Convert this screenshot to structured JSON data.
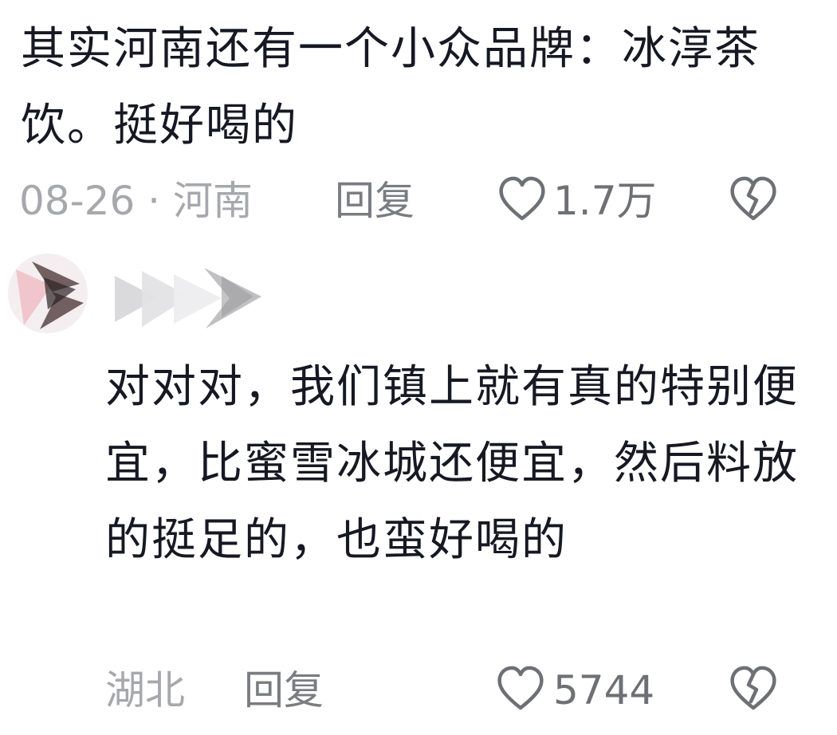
{
  "comments": [
    {
      "text": "其实河南还有一个小众品牌：冰淳茶饮。挺好喝的",
      "meta": "08-26 · 河南",
      "reply_label": "回复",
      "like_count": "1.7万"
    },
    {
      "text": "对对对，我们镇上就有真的特别便宜，比蜜雪冰城还便宜，然后料放的挺足的，也蛮好喝的",
      "meta": "湖北",
      "reply_label": "回复",
      "like_count": "5744"
    }
  ],
  "icons": {
    "like": "heart-outline-icon",
    "dislike": "broken-heart-icon"
  },
  "colors": {
    "text": "#161823",
    "meta": "#a7a8ad",
    "reply": "#7b7c82",
    "icon": "#6f7076"
  }
}
